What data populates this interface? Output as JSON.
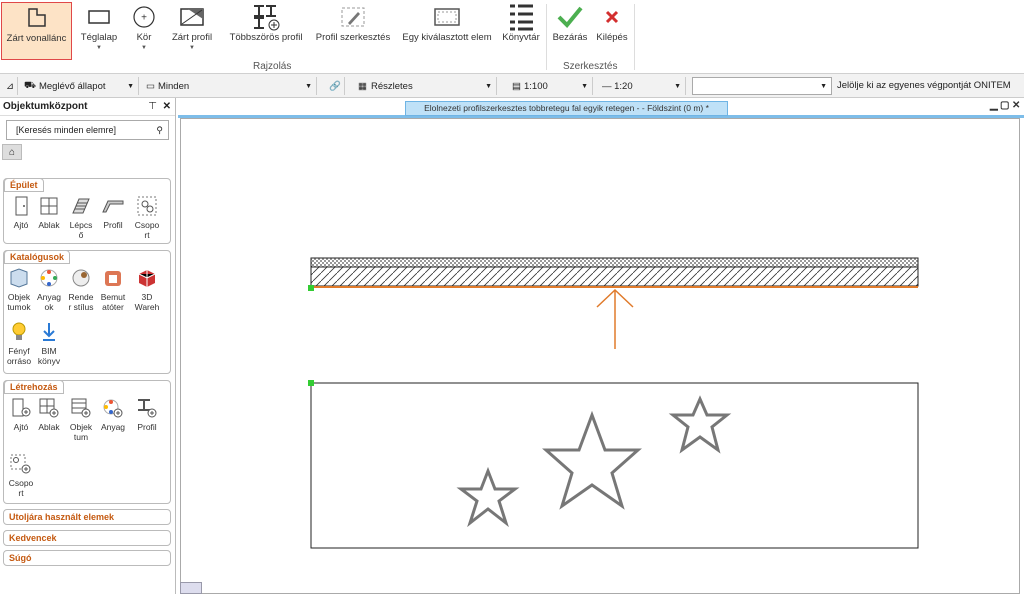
{
  "ribbon": {
    "buttons": {
      "zart_vonallanc": "Zárt vonallánc",
      "teglalap": "Téglalap",
      "kor": "Kör",
      "zart_profil": "Zárt profil",
      "tobbszoros_profil": "Többszörös profil",
      "profil_szerkesztes": "Profil szerkesztés",
      "egy_kivalasztott": "Egy kiválasztott elem",
      "konyvtar": "Könyvtár",
      "bezaras": "Bezárás",
      "kilepes": "Kilépés"
    },
    "groups": {
      "rajzolas": "Rajzolás",
      "szerkesztes": "Szerkesztés"
    }
  },
  "toolbar": {
    "state": "Meglévő állapot",
    "layer": "Minden",
    "detail": "Részletes",
    "scale": "1:100",
    "line": "— 1:20",
    "prompt": "Jelölje ki az egyenes végpontját ONITEM"
  },
  "left_panel": {
    "title": "Objektumközpont",
    "search_placeholder": "[Keresés minden elemre]",
    "sections": {
      "epulet": {
        "title": "Épület",
        "items": [
          "Ajtó",
          "Ablak",
          "Lépcs\nő",
          "Profil",
          "Csopo\nrt"
        ]
      },
      "katalogusok": {
        "title": "Katalógusok",
        "items": [
          "Objek\ntumok",
          "Anyag\nok",
          "Rende\nr stílus",
          "Bemut\natóter",
          "3D\nWareh",
          "Fényf\norráso",
          "BIM\nkönyv"
        ]
      },
      "letrehozas": {
        "title": "Létrehozás",
        "items": [
          "Ajtó",
          "Ablak",
          "Objek\ntum",
          "Anyag",
          "Profil",
          "Csopo\nrt"
        ]
      }
    },
    "collapsed": [
      "Utoljára használt elemek",
      "Kedvencek",
      "Súgó"
    ]
  },
  "document": {
    "tab_title": "Elolnezeti profilszerkesztes tobbretegu fal egyik retegen -  - Földszint (0 m) *"
  },
  "colors": {
    "accent": "#e07a2a",
    "selection": "#e04848",
    "tab": "#bfe1f7"
  }
}
